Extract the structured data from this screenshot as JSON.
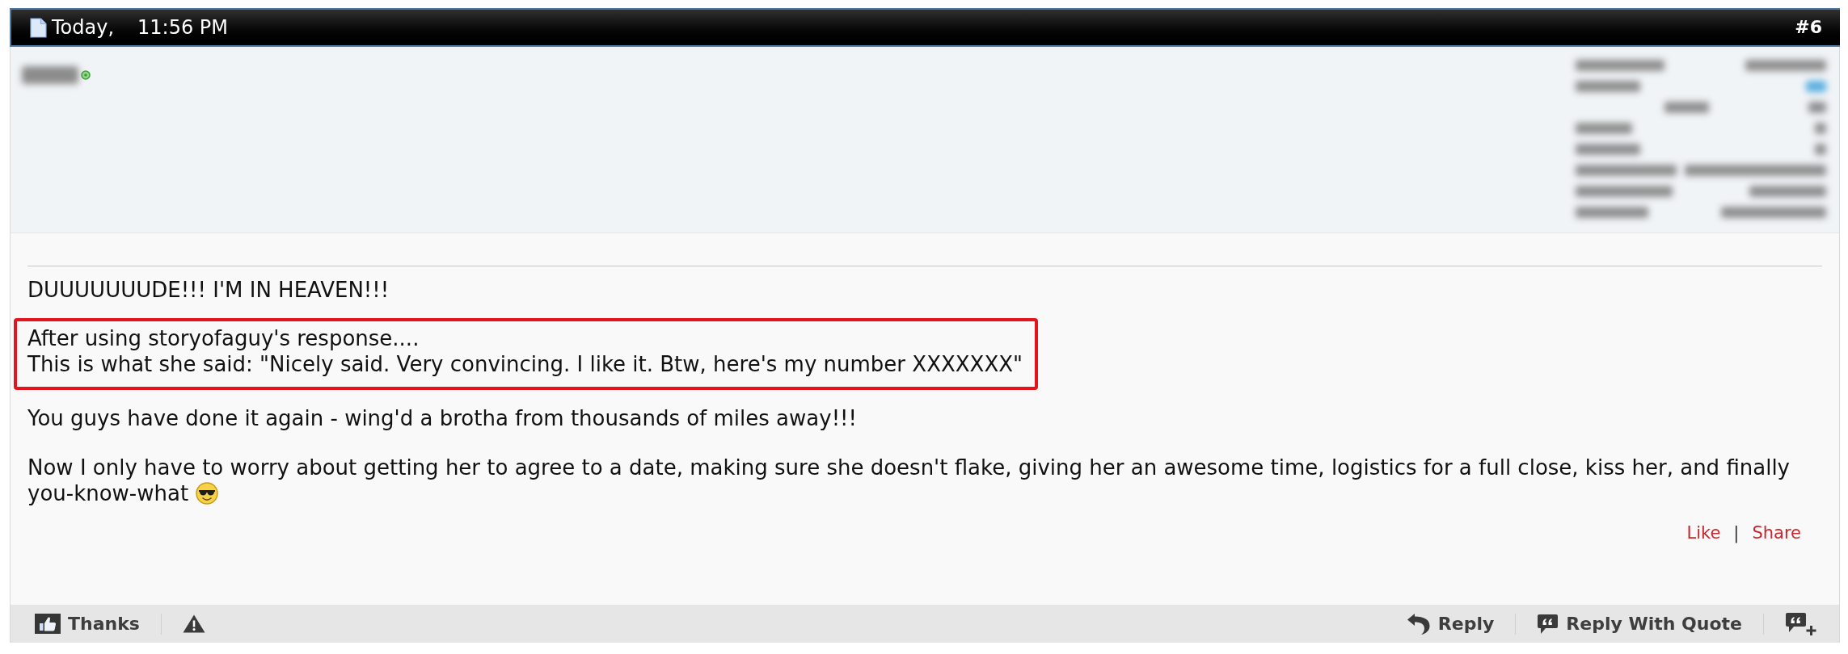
{
  "post": {
    "date": "Today,",
    "time": "11:56 PM",
    "number": "#6"
  },
  "author": {
    "online": true
  },
  "message": [
    {
      "kind": "text",
      "text": "DUUUUUUUDE!!! I'M IN HEAVEN!!!"
    },
    {
      "kind": "highlight",
      "lines": [
        "After using storyofaguy's response....",
        "This is what she said: \"Nicely said. Very convincing. I like it. Btw, here's my number XXXXXXX\""
      ]
    },
    {
      "kind": "text",
      "text": "You guys have done it again - wing'd a brotha from thousands of miles away!!!"
    },
    {
      "kind": "text",
      "text": "Now I only have to worry about getting her to agree to a date, making sure she doesn't flake, giving her an awesome time, logistics for a full close, kiss her, and finally you-know-what",
      "emoji": true
    }
  ],
  "post_links": {
    "like": "Like",
    "separator": "|",
    "share": "Share"
  },
  "toolbar": {
    "left": [
      {
        "kind": "thanks",
        "label": "Thanks"
      },
      {
        "kind": "report"
      }
    ],
    "right": [
      {
        "kind": "reply",
        "label": "Reply"
      },
      {
        "kind": "quote",
        "label": "Reply With Quote"
      },
      {
        "kind": "multiquote"
      }
    ]
  }
}
